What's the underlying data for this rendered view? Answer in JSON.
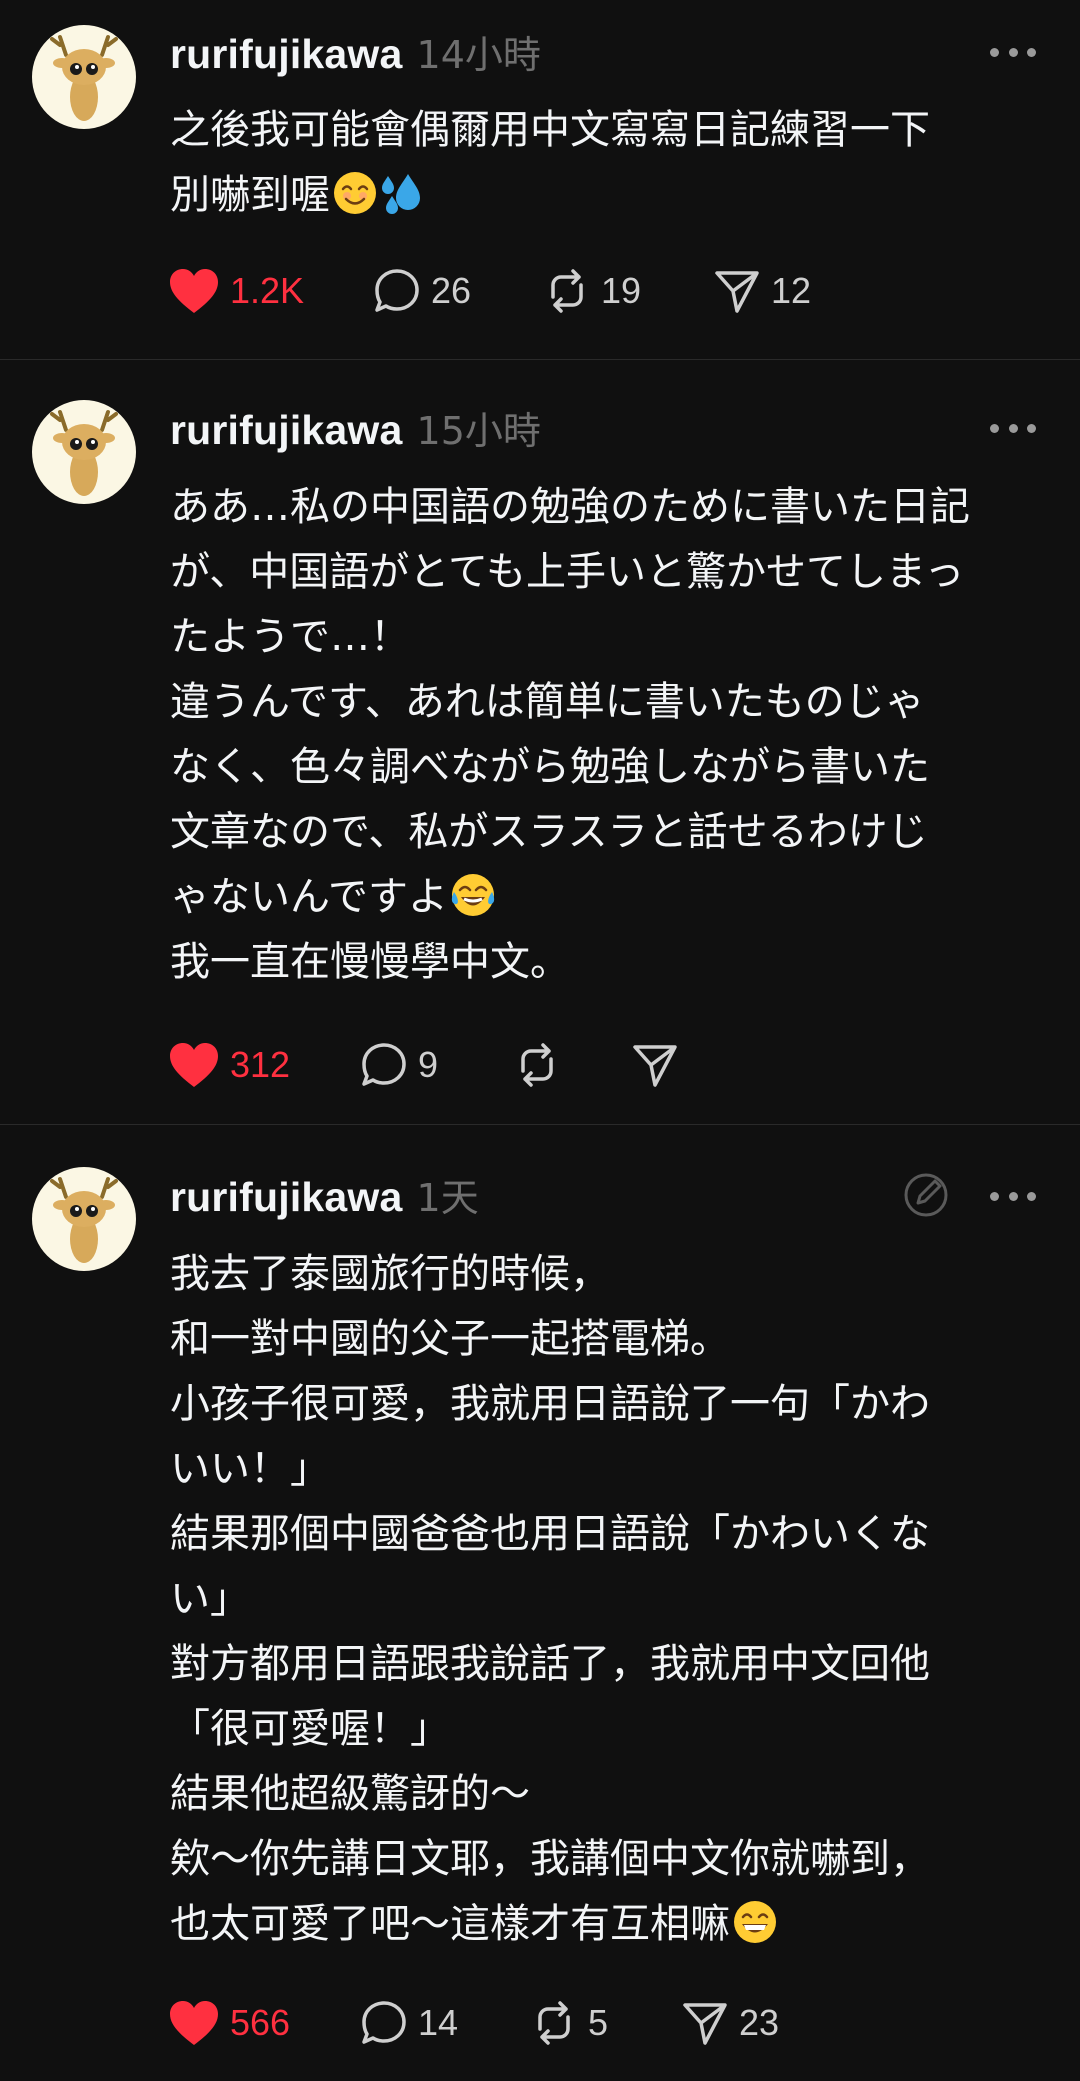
{
  "colors": {
    "background": "#101010",
    "text": "#f3f5f7",
    "muted": "#6f6f6f",
    "like": "#ff3040",
    "divider": "#2a2a2a"
  },
  "posts": [
    {
      "username": "rurifujikawa",
      "time": "14小時",
      "lines": [
        "之後我可能會偶爾用中文寫寫日記練習一下",
        "別嚇到喔"
      ],
      "emojis": [
        "smiling-face",
        "sweat-droplets"
      ],
      "likes": "1.2K",
      "liked": true,
      "comments": "26",
      "reposts": "19",
      "shares": "12"
    },
    {
      "username": "rurifujikawa",
      "time": "15小時",
      "lines": [
        "ああ…私の中国語の勉強のために書いた日記",
        "が、中国語がとても上手いと驚かせてしまっ",
        "たようで…！",
        "違うんです、あれは簡単に書いたものじゃ",
        "なく、色々調べながら勉強しながら書いた",
        "文章なので、私がスラスラと話せるわけじ",
        "ゃないんですよ",
        "我一直在慢慢學中文。"
      ],
      "emojis": [
        "tears-of-joy"
      ],
      "likes": "312",
      "liked": true,
      "comments": "9",
      "reposts": "",
      "shares": ""
    },
    {
      "username": "rurifujikawa",
      "time": "1天",
      "lines": [
        "我去了泰國旅行的時候，",
        "和一對中國的父子一起搭電梯。",
        "小孩子很可愛，我就用日語說了一句「かわ",
        "いい！」",
        "結果那個中國爸爸也用日語說「かわいくな",
        "い」",
        "對方都用日語跟我說話了，我就用中文回他",
        "「很可愛喔！」",
        "結果他超級驚訝的～",
        "欸～你先講日文耶，我講個中文你就嚇到，",
        "也太可愛了吧～這樣才有互相嘛"
      ],
      "emojis": [
        "grinning-face"
      ],
      "likes": "566",
      "liked": true,
      "comments": "14",
      "reposts": "5",
      "shares": "23"
    }
  ]
}
